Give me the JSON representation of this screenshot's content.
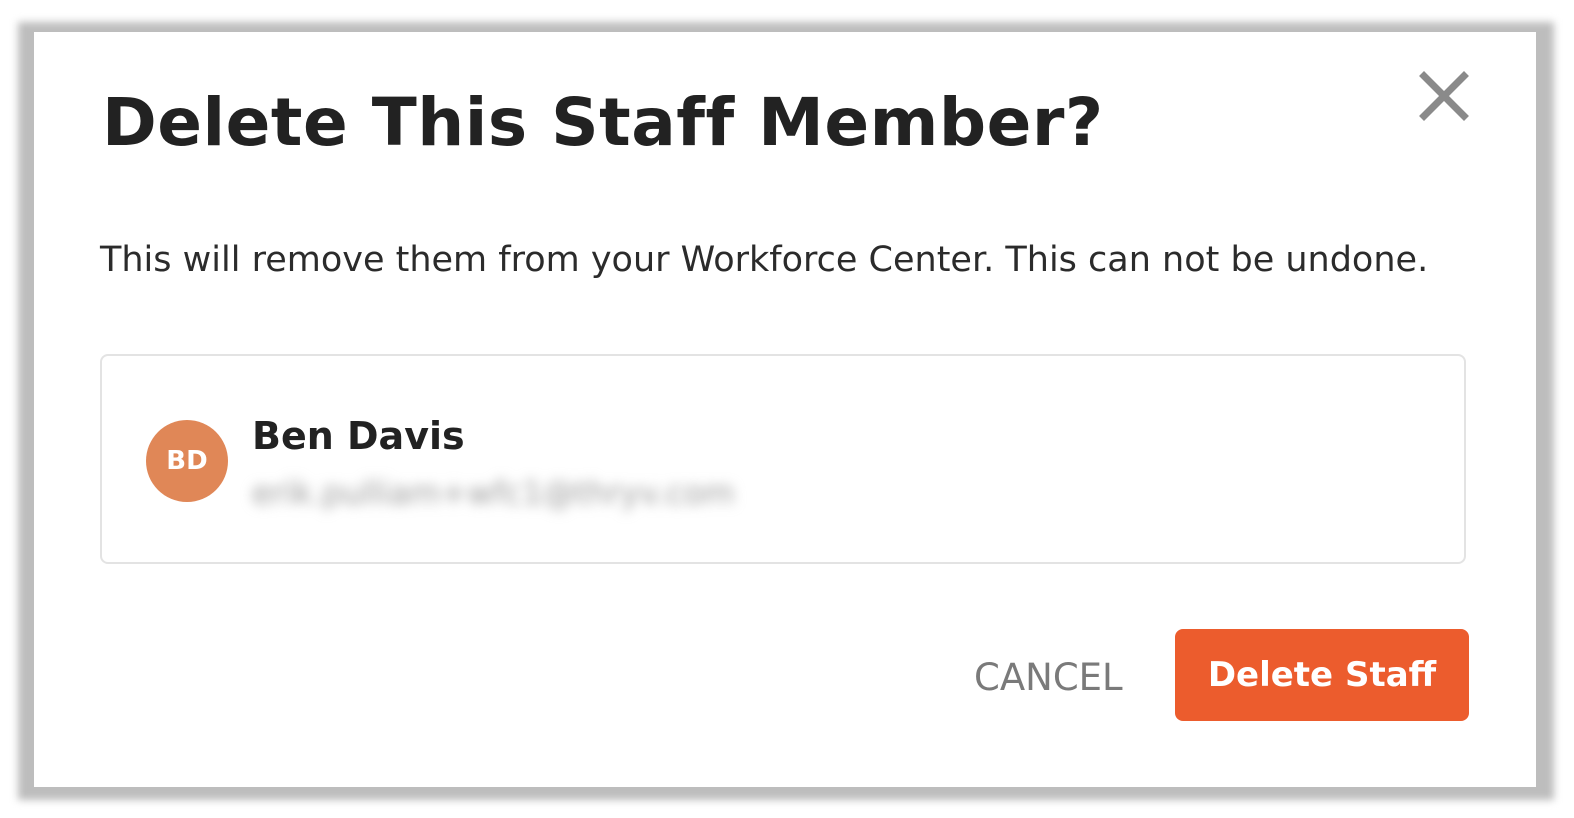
{
  "dialog": {
    "title": "Delete This Staff Member?",
    "close_icon": "close-icon",
    "description": "This will remove them from your Workforce Center. This can not be undone."
  },
  "staff": {
    "initials": "BD",
    "name": "Ben Davis",
    "email": "erik.pulliam+wfc1@thryv.com",
    "avatar_color": "#e08757"
  },
  "actions": {
    "cancel_label": "CANCEL",
    "delete_label": "Delete Staff",
    "delete_color": "#ec5c2d"
  }
}
